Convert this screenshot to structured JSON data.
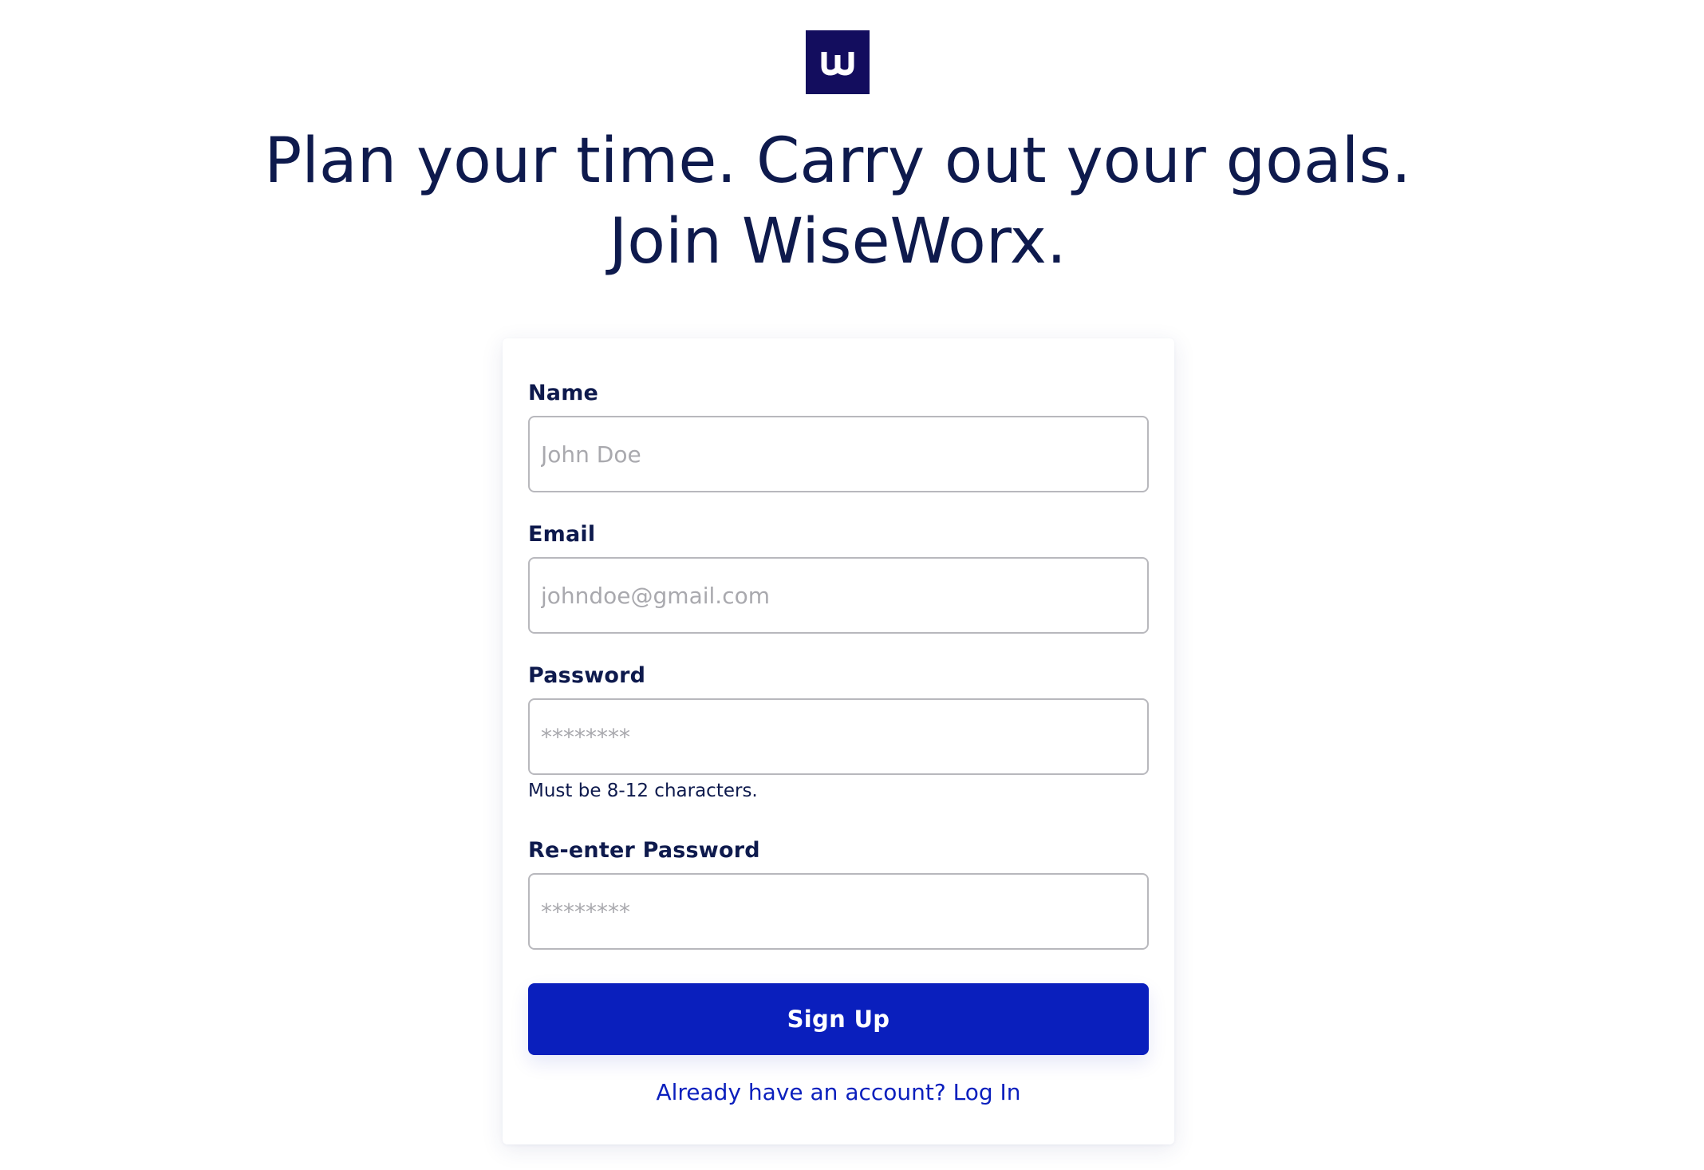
{
  "brand": {
    "logo_letter": "w",
    "logo_color": "#130d5e",
    "accent_color": "#0a1fbd"
  },
  "headline": {
    "line1": "Plan your time. Carry out your goals.",
    "line2": "Join WiseWorx."
  },
  "form": {
    "name": {
      "label": "Name",
      "placeholder": "John Doe",
      "value": ""
    },
    "email": {
      "label": "Email",
      "placeholder": "johndoe@gmail.com",
      "value": ""
    },
    "password": {
      "label": "Password",
      "placeholder": "********",
      "value": "",
      "hint": "Must be 8-12 characters."
    },
    "confirm_password": {
      "label": "Re-enter Password",
      "placeholder": "********",
      "value": ""
    },
    "submit_label": "Sign Up",
    "login_prompt": "Already have an account? Log In"
  }
}
